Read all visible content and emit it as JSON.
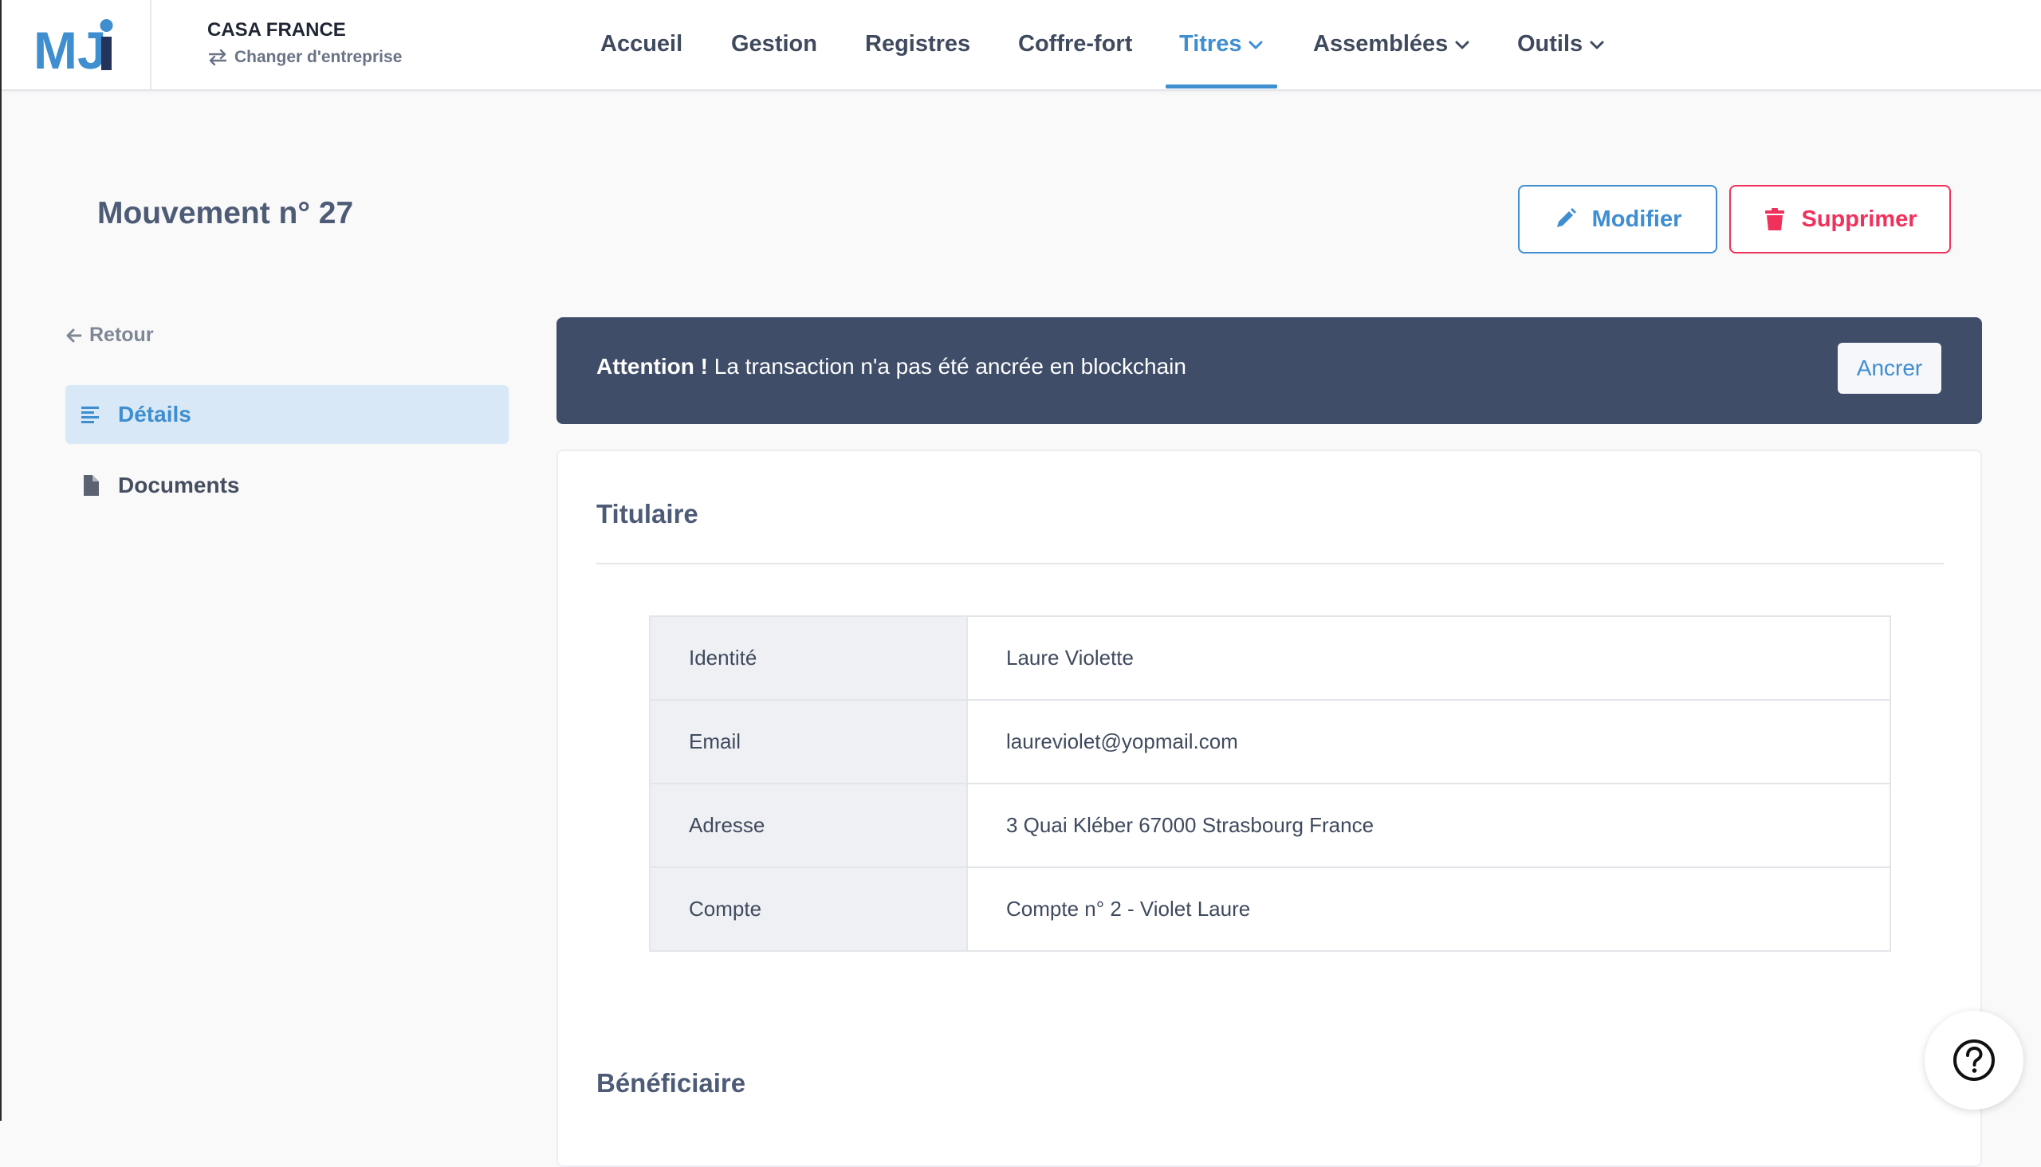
{
  "brand": {
    "logo_text": "MJi",
    "logo_color_primary": "#3e8ed0",
    "logo_color_dark": "#24335a"
  },
  "company": {
    "name": "CASA FRANCE",
    "switch_label": "Changer d'entreprise",
    "switch_icon": "swap-arrows-icon"
  },
  "nav": {
    "items": [
      {
        "label": "Accueil"
      },
      {
        "label": "Gestion"
      },
      {
        "label": "Registres"
      },
      {
        "label": "Coffre-fort"
      },
      {
        "label": "Titres",
        "active": true,
        "dropdown": true
      },
      {
        "label": "Assemblées",
        "dropdown": true
      },
      {
        "label": "Outils",
        "dropdown": true
      }
    ]
  },
  "page": {
    "title": "Mouvement n° 27",
    "edit_label": "Modifier",
    "delete_label": "Supprimer"
  },
  "sidebar": {
    "back_label": "Retour",
    "items": [
      {
        "label": "Détails",
        "active": true,
        "icon": "details-lines-icon"
      },
      {
        "label": "Documents",
        "icon": "document-icon"
      }
    ]
  },
  "alert": {
    "strong": "Attention !",
    "message": " La transaction n'a pas été ancrée en blockchain",
    "action_label": "Ancrer"
  },
  "holder": {
    "title": "Titulaire",
    "rows": [
      {
        "key": "Identité",
        "value": "Laure Violette"
      },
      {
        "key": "Email",
        "value": "laureviolet@yopmail.com"
      },
      {
        "key": "Adresse",
        "value": "3 Quai Kléber 67000 Strasbourg France"
      },
      {
        "key": "Compte",
        "value": "Compte n° 2 - Violet Laure"
      }
    ]
  },
  "beneficiary": {
    "title": "Bénéficiaire"
  },
  "help": {
    "icon": "help-circle-icon"
  },
  "colors": {
    "accent": "#3e8ed0",
    "danger": "#f0315c",
    "alert_bg": "#3f4d69"
  }
}
